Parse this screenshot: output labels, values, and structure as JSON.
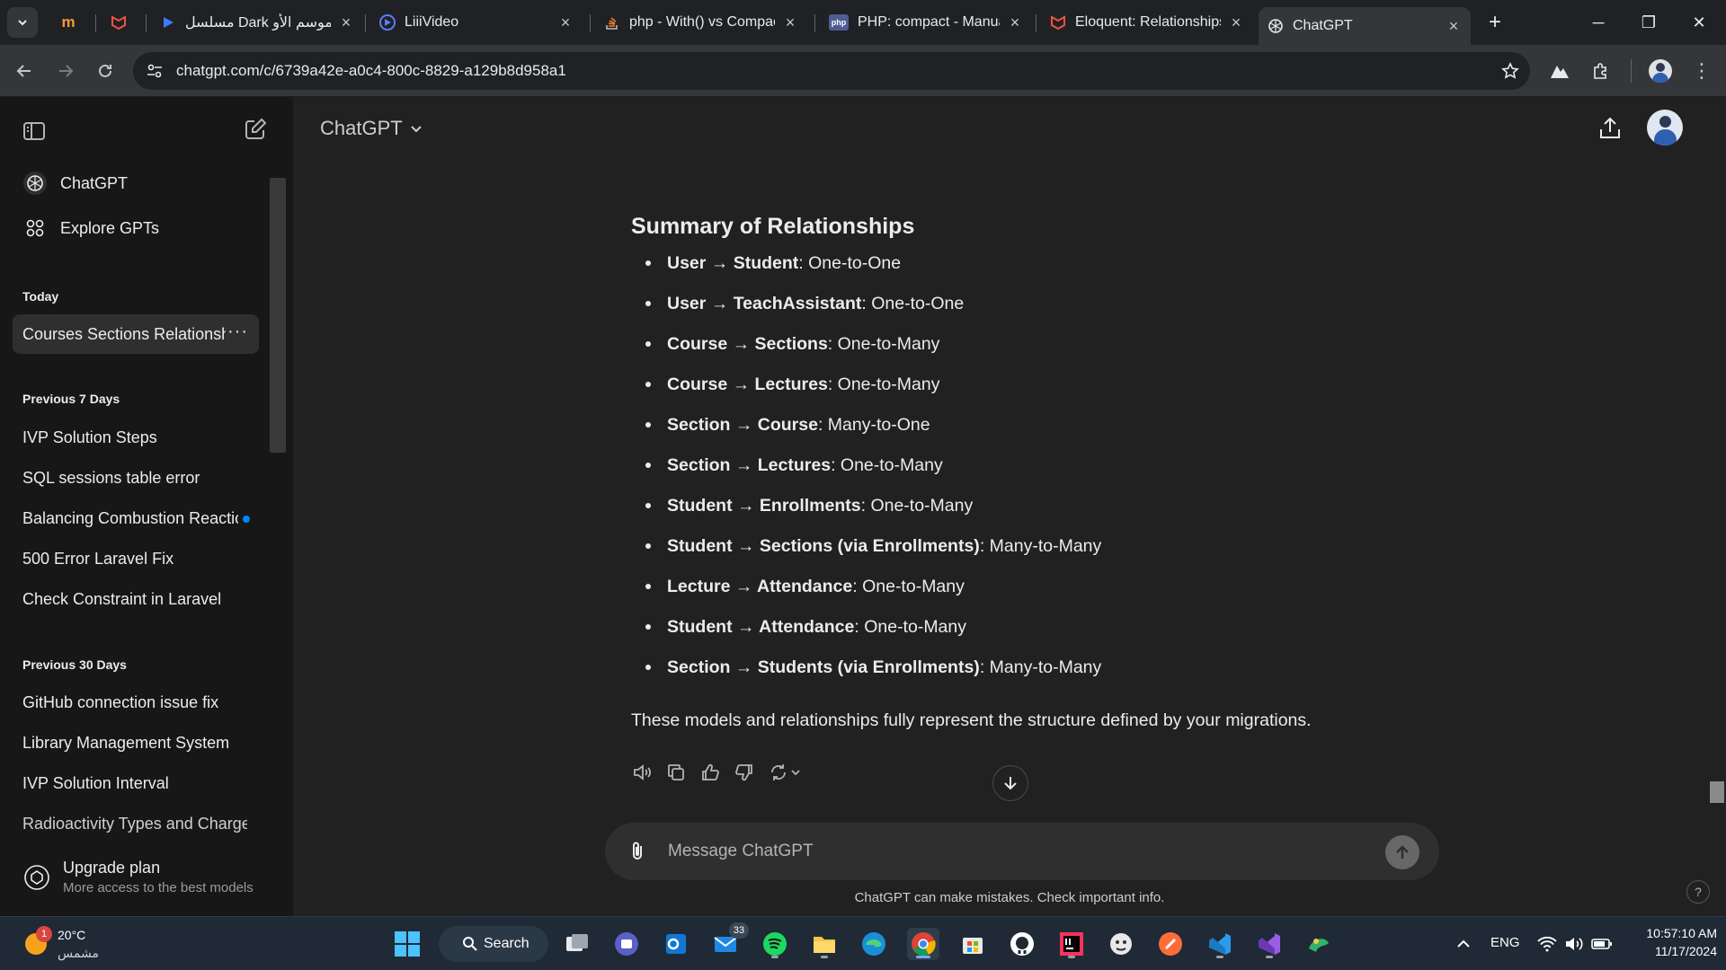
{
  "browser": {
    "tabs": [
      {
        "title": "مسلسل Dark الموسم الأو",
        "active": false
      },
      {
        "title": "LiiiVideo",
        "active": false
      },
      {
        "title": "php - With() vs Compac",
        "active": false
      },
      {
        "title": "PHP: compact - Manual",
        "active": false
      },
      {
        "title": "Eloquent: Relationships",
        "active": false
      },
      {
        "title": "ChatGPT",
        "active": true
      }
    ],
    "pinned_label": "m",
    "php_fav": "php",
    "url": "chatgpt.com/c/6739a42e-a0c4-800c-8829-a129b8d958a1"
  },
  "sidebar": {
    "nav": [
      {
        "label": "ChatGPT"
      },
      {
        "label": "Explore GPTs"
      }
    ],
    "sections": [
      {
        "heading": "Today",
        "items": [
          {
            "label": "Courses Sections Relationshi",
            "active": true
          }
        ]
      },
      {
        "heading": "Previous 7 Days",
        "items": [
          {
            "label": "IVP Solution Steps"
          },
          {
            "label": "SQL sessions table error"
          },
          {
            "label": "Balancing Combustion Reaction"
          },
          {
            "label": "500 Error Laravel Fix"
          },
          {
            "label": "Check Constraint in Laravel"
          }
        ]
      },
      {
        "heading": "Previous 30 Days",
        "items": [
          {
            "label": "GitHub connection issue fix"
          },
          {
            "label": "Library Management System"
          },
          {
            "label": "IVP Solution Interval"
          },
          {
            "label": "Radioactivity Types and Charges"
          }
        ]
      }
    ],
    "upgrade": {
      "title": "Upgrade plan",
      "subtitle": "More access to the best models"
    }
  },
  "main": {
    "model": "ChatGPT",
    "heading": "Summary of Relationships",
    "relationships": [
      {
        "bold": "User → Student",
        "rest": ": One-to-One"
      },
      {
        "bold": "User → TeachAssistant",
        "rest": ": One-to-One"
      },
      {
        "bold": "Course → Sections",
        "rest": ": One-to-Many"
      },
      {
        "bold": "Course → Lectures",
        "rest": ": One-to-Many"
      },
      {
        "bold": "Section → Course",
        "rest": ": Many-to-One"
      },
      {
        "bold": "Section → Lectures",
        "rest": ": One-to-Many"
      },
      {
        "bold": "Student → Enrollments",
        "rest": ": One-to-Many"
      },
      {
        "bold": "Student → Sections (via Enrollments)",
        "rest": ": Many-to-Many"
      },
      {
        "bold": "Lecture → Attendance",
        "rest": ": One-to-Many"
      },
      {
        "bold": "Student → Attendance",
        "rest": ": One-to-Many"
      },
      {
        "bold": "Section → Students (via Enrollments)",
        "rest": ": Many-to-Many"
      }
    ],
    "closing": "These models and relationships fully represent the structure defined by your migrations.",
    "composer_placeholder": "Message ChatGPT",
    "disclaimer": "ChatGPT can make mistakes. Check important info."
  },
  "taskbar": {
    "weather": {
      "temp": "20°C",
      "desc": "مشمس",
      "badge": "1"
    },
    "search_label": "Search",
    "mail_badge": "33",
    "lang": "ENG",
    "time": "10:57:10 AM",
    "date": "11/17/2024"
  },
  "colors": {
    "accent_blue": "#0285ff",
    "sidebar": "#171717",
    "main": "#212121"
  }
}
